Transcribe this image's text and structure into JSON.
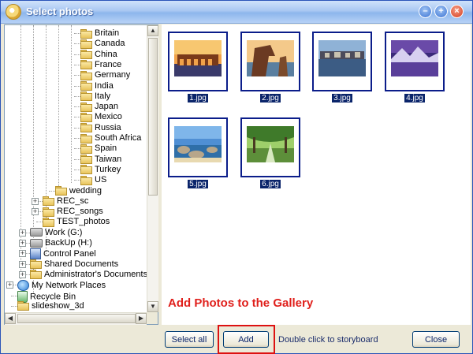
{
  "window": {
    "title": "Select photos"
  },
  "tree": {
    "items": [
      {
        "label": "Britain",
        "icon": "folder-icon",
        "depth": 6
      },
      {
        "label": "Canada",
        "icon": "folder-icon",
        "depth": 6
      },
      {
        "label": "China",
        "icon": "folder-icon",
        "depth": 6
      },
      {
        "label": "France",
        "icon": "folder-icon",
        "depth": 6
      },
      {
        "label": "Germany",
        "icon": "folder-icon",
        "depth": 6
      },
      {
        "label": "India",
        "icon": "folder-icon",
        "depth": 6
      },
      {
        "label": "Italy",
        "icon": "folder-icon",
        "depth": 6
      },
      {
        "label": "Japan",
        "icon": "folder-icon",
        "depth": 6
      },
      {
        "label": "Mexico",
        "icon": "folder-icon",
        "depth": 6
      },
      {
        "label": "Russia",
        "icon": "folder-icon",
        "depth": 6
      },
      {
        "label": "South Africa",
        "icon": "folder-icon",
        "depth": 6
      },
      {
        "label": "Spain",
        "icon": "folder-icon",
        "depth": 6
      },
      {
        "label": "Taiwan",
        "icon": "folder-icon",
        "depth": 6
      },
      {
        "label": "Turkey",
        "icon": "folder-icon",
        "depth": 6
      },
      {
        "label": "US",
        "icon": "folder-icon",
        "depth": 6
      },
      {
        "label": "wedding",
        "icon": "folder-icon",
        "depth": 4
      },
      {
        "label": "REC_sc",
        "icon": "folder-icon",
        "depth": 3,
        "expander": "+"
      },
      {
        "label": "REC_songs",
        "icon": "folder-icon",
        "depth": 3,
        "expander": "+"
      },
      {
        "label": "TEST_photos",
        "icon": "folder-icon",
        "depth": 3
      },
      {
        "label": "Work (G:)",
        "icon": "drive-icon",
        "depth": 2,
        "expander": "+"
      },
      {
        "label": "BackUp (H:)",
        "icon": "drive-icon",
        "depth": 2,
        "expander": "+"
      },
      {
        "label": "Control Panel",
        "icon": "control-panel-icon",
        "depth": 2,
        "expander": "+"
      },
      {
        "label": "Shared Documents",
        "icon": "folder-icon",
        "depth": 2,
        "expander": "+"
      },
      {
        "label": "Administrator's Documents",
        "icon": "folder-icon",
        "depth": 2,
        "expander": "+"
      },
      {
        "label": "My Network Places",
        "icon": "network-icon",
        "depth": 1,
        "expander": "+"
      },
      {
        "label": "Recycle Bin",
        "icon": "recycle-bin-icon",
        "depth": 1
      },
      {
        "label": "slideshow_3d",
        "icon": "folder-icon",
        "depth": 1
      }
    ]
  },
  "gallery": {
    "photos": [
      {
        "name": "1.jpg",
        "scene": "aqueduct-sunset"
      },
      {
        "name": "2.jpg",
        "scene": "rock-arch-sea"
      },
      {
        "name": "3.jpg",
        "scene": "lake-village"
      },
      {
        "name": "4.jpg",
        "scene": "purple-mountain-lake"
      },
      {
        "name": "5.jpg",
        "scene": "rocky-beach"
      },
      {
        "name": "6.jpg",
        "scene": "tree-avenue"
      }
    ],
    "caption": "Add Photos to the Gallery"
  },
  "buttons": {
    "select_all": "Select all",
    "add": "Add",
    "close": "Close"
  },
  "hint": "Double click to storyboard",
  "colors": {
    "selection": "#0a246a",
    "thumb_border": "#0b1d8a",
    "caption": "#e0201c",
    "highlight": "#dd1111"
  }
}
